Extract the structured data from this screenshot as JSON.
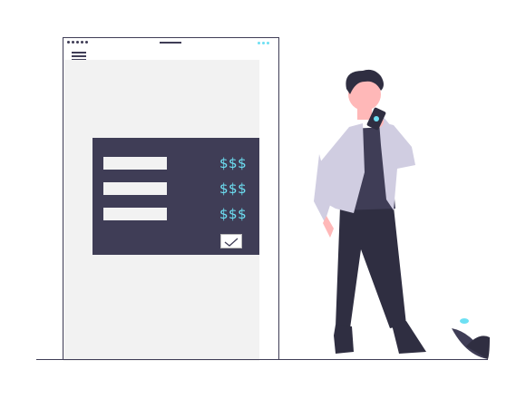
{
  "rows": [
    {
      "price": "$$$"
    },
    {
      "price": "$$$"
    },
    {
      "price": "$$$"
    }
  ],
  "icons": {
    "menu": "hamburger-menu-icon",
    "confirm": "checkmark-icon",
    "phone": "phone-icon"
  },
  "colors": {
    "accent": "#6de0f3",
    "dark": "#3f3d56",
    "screen": "#f2f2f2",
    "jacket": "#d0cde1",
    "skin": "#ffb8b8",
    "hair": "#2f2e41"
  }
}
